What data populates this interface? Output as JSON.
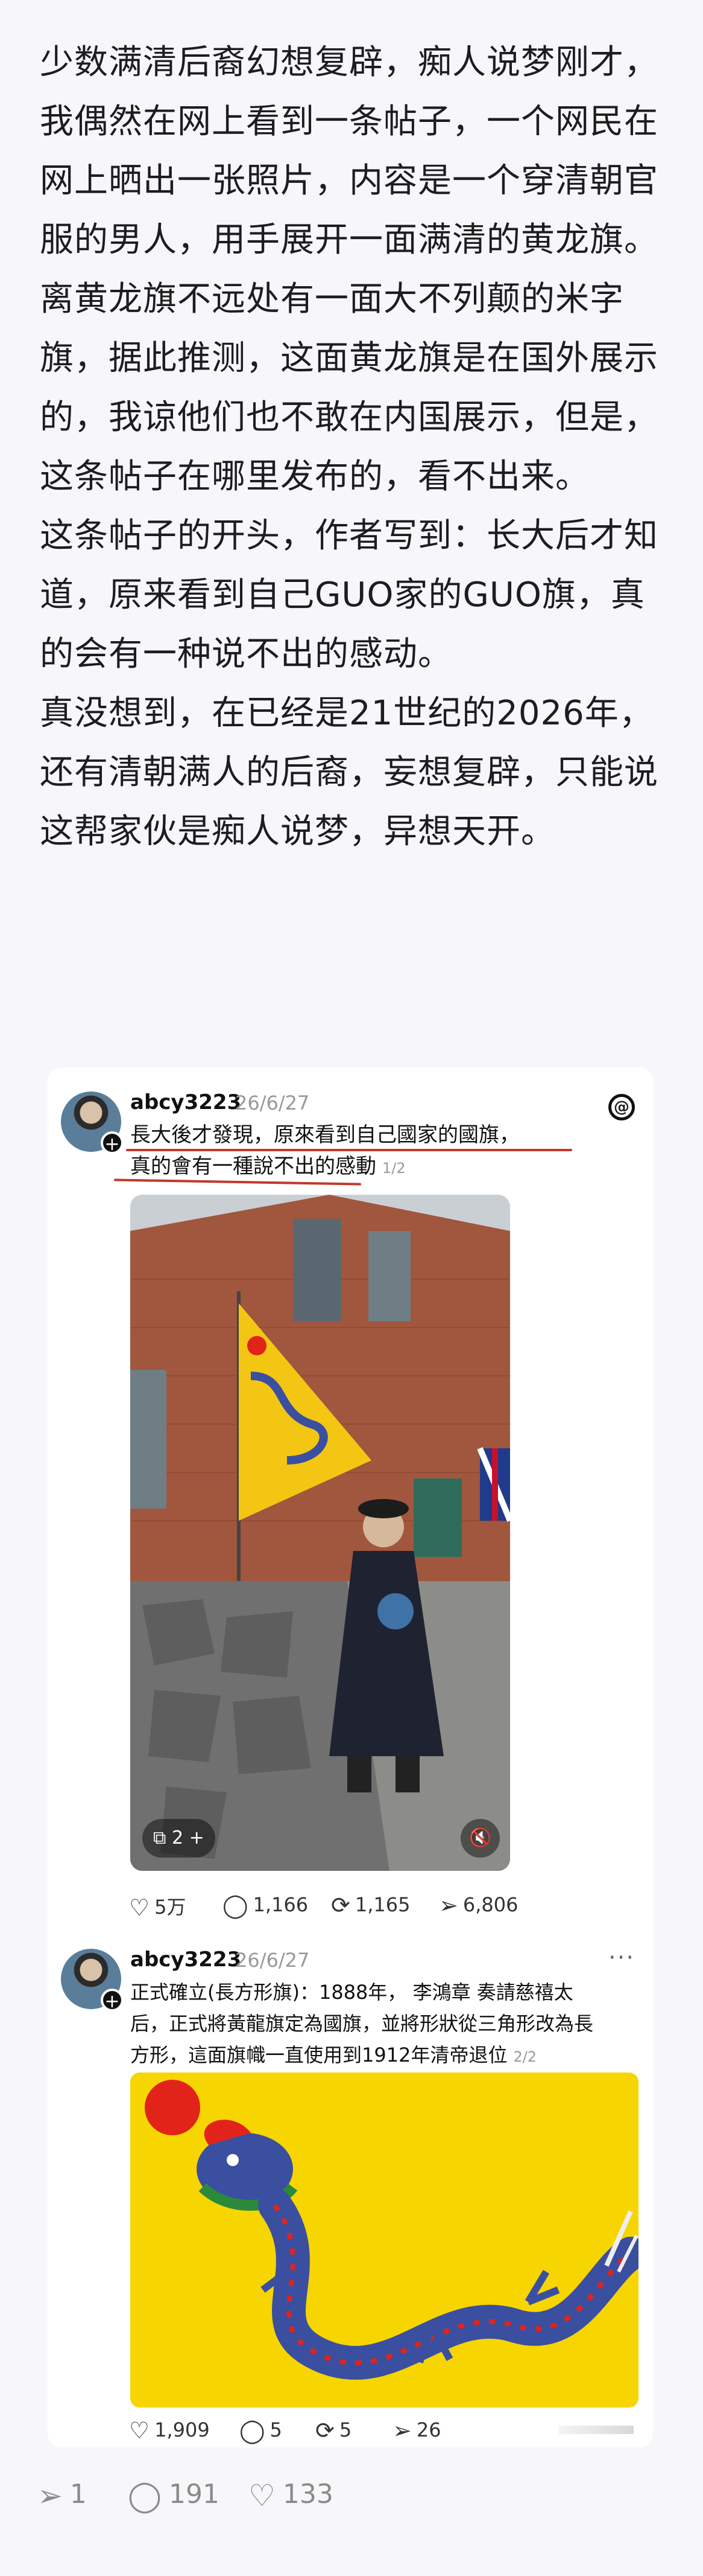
{
  "article": {
    "paragraphs": [
      "少数满清后裔幻想复辟，痴人说梦刚才，我偶然在网上看到一条帖子，一个网民在网上晒出一张照片，内容是一个穿清朝官服的男人，用手展开一面满清的黄龙旗。离黄龙旗不远处有一面大不列颠的米字旗，据此推测，这面黄龙旗是在国外展示的，我谅他们也不敢在内国展示，但是，这条帖子在哪里发布的，看不出来。",
      "这条帖子的开头，作者写到：长大后才知道，原来看到自己GUO家的GUO旗，真的会有一种说不出的感动。",
      "真没想到，在已经是21世纪的2026年，还有清朝满人的后裔，妄想复辟，只能说这帮家伙是痴人说梦，异想天开。"
    ]
  },
  "post1": {
    "username": "abcy3223",
    "date": "26/6/27",
    "text_line1": "長大後才發現，原來看到自己國家的國旗，",
    "text_line2": "真的會有一種說不出的感動",
    "page": "1/2",
    "media_count": "2",
    "likes": "5万",
    "comments": "1,166",
    "reposts": "1,165",
    "shares": "6,806"
  },
  "post2": {
    "username": "abcy3223",
    "date": "26/6/27",
    "text_line1": "正式確立(長方形旗)：1888年，  李鴻章 奏請慈禧太",
    "text_line2": "后，正式將黃龍旗定為國旗，並將形狀從三角形改為長",
    "text_line3": "方形，這面旗幟一直使用到1912年清帝退位",
    "page": "2/2",
    "more": "···",
    "likes": "1,909",
    "comments": "5",
    "reposts": "5",
    "shares": "26"
  },
  "footer": {
    "shares": "1",
    "comments": "191",
    "likes": "133"
  },
  "icons": {
    "heart": "♡",
    "comment": "◯",
    "repost": "⟳",
    "share": "➢",
    "threads": "@",
    "plus": "+",
    "mute": "🔇",
    "gallery": "⧉"
  },
  "colors": {
    "flag_yellow": "#f7d500",
    "dragon_blue": "#3a4fa0",
    "pearl_red": "#e2231a",
    "underline_red": "#c0392b"
  }
}
